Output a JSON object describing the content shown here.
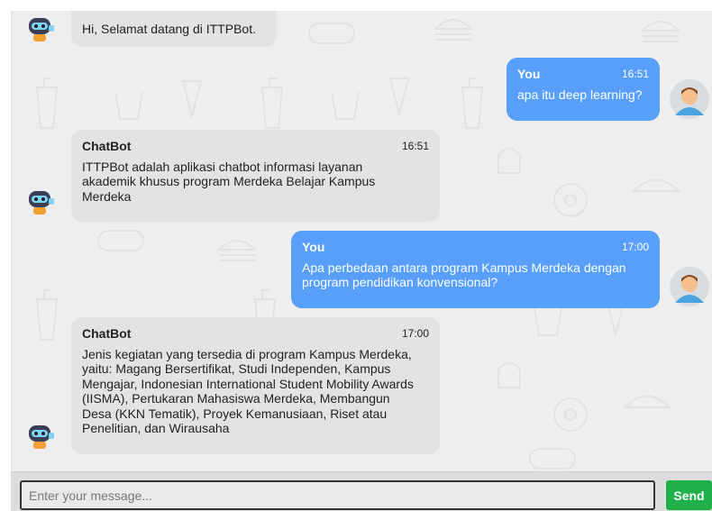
{
  "messages": [
    {
      "sender": "",
      "time": "",
      "text": "Hi, Selamat datang di ITTPBot."
    },
    {
      "sender": "You",
      "time": "16:51",
      "text": "apa itu deep learning?"
    },
    {
      "sender": "ChatBot",
      "time": "16:51",
      "text": "ITTPBot adalah aplikasi chatbot informasi layanan akademik khusus program Merdeka Belajar Kampus Merdeka"
    },
    {
      "sender": "You",
      "time": "17:00",
      "text": "Apa perbedaan antara program Kampus Merdeka dengan program pendidikan konvensional?"
    },
    {
      "sender": "ChatBot",
      "time": "17:00",
      "text": "Jenis kegiatan yang tersedia di program Kampus Merdeka, yaitu: Magang Bersertifikat, Studi Independen, Kampus Mengajar, Indonesian International Student Mobility Awards (IISMA), Pertukaran Mahasiswa Merdeka, Membangun Desa (KKN Tematik), Proyek Kemanusiaan, Riset atau Penelitian, dan Wirausaha"
    }
  ],
  "composer": {
    "placeholder": "Enter your message...",
    "send_label": "Send"
  },
  "colors": {
    "user_bubble": "#579ffb",
    "bot_bubble": "#e3e3e3",
    "send_button": "#1fb04a",
    "chat_bg": "#eeeeee"
  },
  "icons": {
    "bot_avatar": "robot-avatar-icon",
    "user_avatar": "user-avatar-icon"
  }
}
